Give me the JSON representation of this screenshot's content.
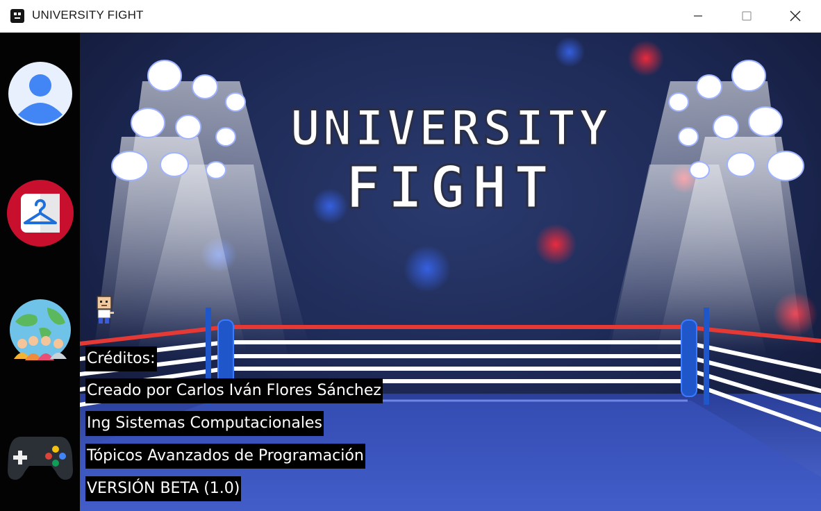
{
  "window": {
    "title": "UNIVERSITY FIGHT",
    "controls": [
      "minimize",
      "maximize",
      "close"
    ]
  },
  "sidebar": {
    "items": [
      {
        "icon": "user-profile-icon",
        "color": "#4285f4"
      },
      {
        "icon": "hanger-wardrobe-icon",
        "color": "#c8102e"
      },
      {
        "icon": "world-community-icon",
        "color": "#3fae6b"
      },
      {
        "icon": "gamepad-icon",
        "color": "#2b2f36"
      }
    ]
  },
  "game": {
    "logo": {
      "line1": "UNIVERSITY",
      "line2": "FIGHT"
    },
    "scene": "boxing-ring-with-spotlights",
    "credits": {
      "heading": "Créditos:",
      "lines": [
        "Creado por Carlos Iván Flores Sánchez",
        "Ing Sistemas Computacionales",
        "Tópicos Avanzados de Programación",
        "VERSIÓN BETA (1.0)"
      ]
    }
  },
  "colors": {
    "background_navy": "#1b2444",
    "ring_top_rope": "#e53935",
    "ring_post": "#1f56c9",
    "ring_canvas": "#3d58c4"
  }
}
